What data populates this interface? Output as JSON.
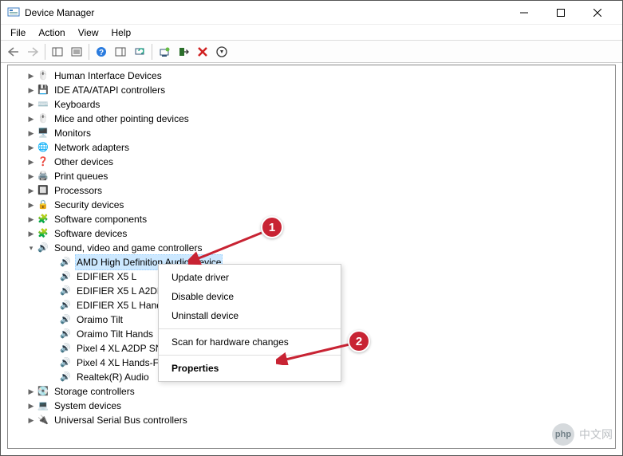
{
  "window": {
    "title": "Device Manager"
  },
  "menu": {
    "file": "File",
    "action": "Action",
    "view": "View",
    "help": "Help"
  },
  "tree": {
    "hid": "Human Interface Devices",
    "ide": "IDE ATA/ATAPI controllers",
    "keyboards": "Keyboards",
    "mice": "Mice and other pointing devices",
    "monitors": "Monitors",
    "network": "Network adapters",
    "other": "Other devices",
    "printq": "Print queues",
    "processors": "Processors",
    "security": "Security devices",
    "swcomps": "Software components",
    "swdevs": "Software devices",
    "sound": "Sound, video and game controllers",
    "sound_children": {
      "amd": "AMD High Definition Audio Device",
      "edx5l": "EDIFIER X5 L",
      "edx5la2dp": "EDIFIER X5 L A2DP",
      "edx5lhand": "EDIFIER X5 L Hand",
      "oraimo": "Oraimo Tilt",
      "oraimohands": "Oraimo Tilt Hands",
      "pixela2dp": "Pixel 4 XL A2DP SN",
      "pixelhands": "Pixel 4 XL Hands-F",
      "realtek": "Realtek(R) Audio"
    },
    "storage": "Storage controllers",
    "sysdev": "System devices",
    "usb": "Universal Serial Bus controllers"
  },
  "context_menu": {
    "update": "Update driver",
    "disable": "Disable device",
    "uninstall": "Uninstall device",
    "scan": "Scan for hardware changes",
    "properties": "Properties"
  },
  "annotations": {
    "b1": "1",
    "b2": "2"
  },
  "watermark": {
    "logo": "php",
    "text": "中文网"
  }
}
